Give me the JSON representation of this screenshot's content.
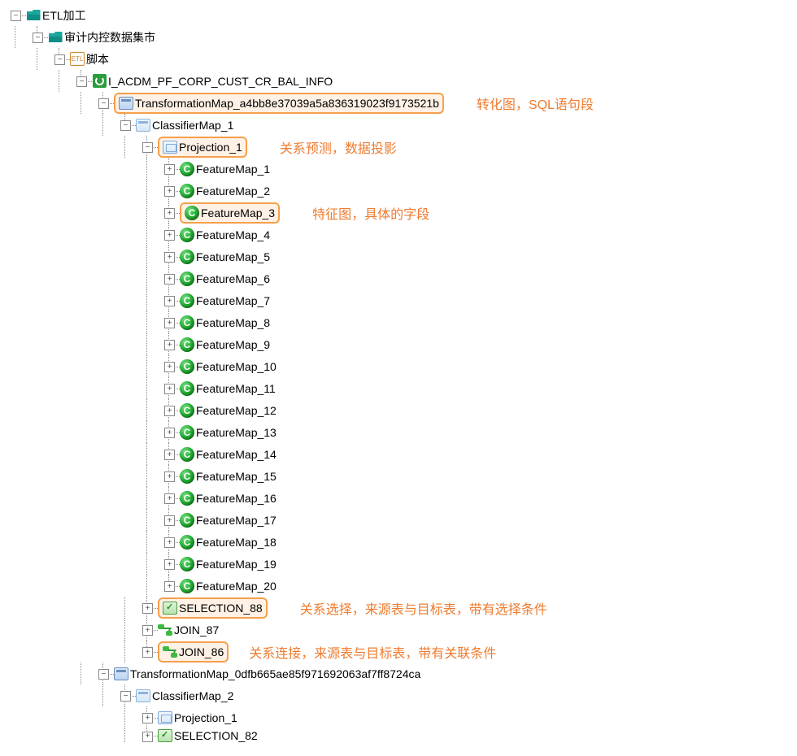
{
  "root": {
    "label": "ETL加工"
  },
  "sub1": {
    "label": "审计内控数据集市"
  },
  "scripts": {
    "label": "脚本",
    "etl_tag": "ETL"
  },
  "job": {
    "label": "I_ACDM_PF_CORP_CUST_CR_BAL_INFO"
  },
  "tmap1": {
    "label": "TransformationMap_a4bb8e37039a5a836319023f9173521b",
    "annot": "转化图，SQL语句段"
  },
  "cls1": {
    "label": "ClassifierMap_1"
  },
  "proj1": {
    "label": "Projection_1",
    "annot": "关系预测，数据投影"
  },
  "features": [
    "FeatureMap_1",
    "FeatureMap_2",
    "FeatureMap_3",
    "FeatureMap_4",
    "FeatureMap_5",
    "FeatureMap_6",
    "FeatureMap_7",
    "FeatureMap_8",
    "FeatureMap_9",
    "FeatureMap_10",
    "FeatureMap_11",
    "FeatureMap_12",
    "FeatureMap_13",
    "FeatureMap_14",
    "FeatureMap_15",
    "FeatureMap_16",
    "FeatureMap_17",
    "FeatureMap_18",
    "FeatureMap_19",
    "FeatureMap_20"
  ],
  "feature_annot_index": 2,
  "feature_annot": "特征图，具体的字段",
  "sel88": {
    "label": "SELECTION_88",
    "annot": "关系选择，来源表与目标表，带有选择条件"
  },
  "join87": {
    "label": "JOIN_87"
  },
  "join86": {
    "label": "JOIN_86",
    "annot": "关系连接，来源表与目标表，带有关联条件"
  },
  "tmap2": {
    "label": "TransformationMap_0dfb665ae85f971692063af7ff8724ca"
  },
  "cls2": {
    "label": "ClassifierMap_2"
  },
  "proj2": {
    "label": "Projection_1"
  },
  "sel82": {
    "label": "SELECTION_82"
  }
}
